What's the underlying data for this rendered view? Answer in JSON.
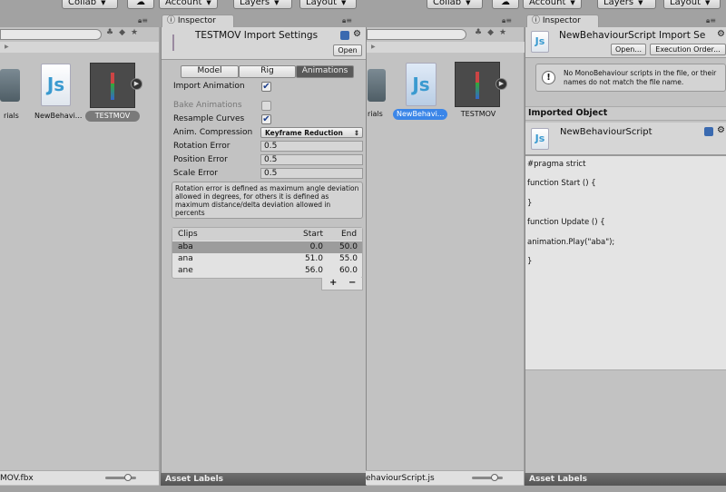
{
  "toolbar": {
    "collab": "Collab",
    "account": "Account",
    "layers": "Layers",
    "layout": "Layout"
  },
  "left": {
    "project": {
      "items": [
        "rials",
        "NewBehavi...",
        "TESTMOV"
      ],
      "status_file": "MOV.fbx"
    },
    "inspector": {
      "tab": "Inspector",
      "title": "TESTMOV Import Settings",
      "open": "Open",
      "tabs": [
        "Model",
        "Rig",
        "Animations"
      ],
      "active_tab": "Animations",
      "import_animation": {
        "label": "Import Animation",
        "checked": true
      },
      "bake_animations": {
        "label": "Bake Animations",
        "checked": false
      },
      "resample_curves": {
        "label": "Resample Curves",
        "checked": true
      },
      "anim_compression": {
        "label": "Anim. Compression",
        "value": "Keyframe Reduction"
      },
      "rotation_error": {
        "label": "Rotation Error",
        "value": "0.5"
      },
      "position_error": {
        "label": "Position Error",
        "value": "0.5"
      },
      "scale_error": {
        "label": "Scale Error",
        "value": "0.5"
      },
      "help": "Rotation error is defined as maximum angle deviation allowed in degrees, for others it is defined as maximum distance/delta deviation allowed in percents",
      "clips": {
        "headers": [
          "Clips",
          "Start",
          "End"
        ],
        "rows": [
          [
            "aba",
            "0.0",
            "50.0"
          ],
          [
            "ana",
            "51.0",
            "55.0"
          ],
          [
            "ane",
            "56.0",
            "60.0"
          ]
        ],
        "add": "+",
        "remove": "−"
      },
      "asset_labels": "Asset Labels"
    }
  },
  "right": {
    "project": {
      "items": [
        "rials",
        "NewBehavi...",
        "TESTMOV"
      ],
      "status_file": "ehaviourScript.js"
    },
    "inspector": {
      "tab": "Inspector",
      "title": "NewBehaviourScript Import Se",
      "open": "Open...",
      "execution_order": "Execution Order...",
      "help": "No MonoBehaviour scripts in the file, or their names do not match the file name.",
      "imported_object": "Imported Object",
      "object_name": "NewBehaviourScript",
      "code": [
        "#pragma strict",
        "function Start () {",
        "}",
        "function Update () {",
        "animation.Play(\"aba\");",
        "}"
      ],
      "asset_labels": "Asset Labels"
    }
  },
  "colors": {
    "selection": "#3b86e8",
    "active_tab": "#5a5a5a"
  }
}
